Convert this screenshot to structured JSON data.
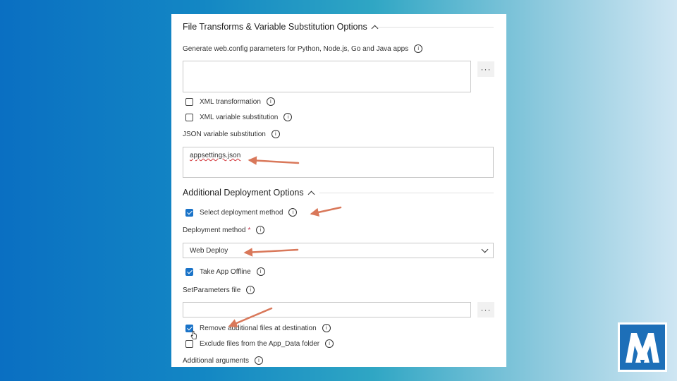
{
  "file_transforms": {
    "title": "File Transforms & Variable Substitution Options",
    "webconfig_label": "Generate web.config parameters for Python, Node.js, Go and Java apps",
    "webconfig_value": "",
    "more_button": "···",
    "xml_transformation": {
      "label": "XML transformation",
      "checked": false
    },
    "xml_variable_substitution": {
      "label": "XML variable substitution",
      "checked": false
    },
    "json_label": "JSON variable substitution",
    "json_value": "appsettings.json"
  },
  "deployment": {
    "title": "Additional Deployment Options",
    "select_method": {
      "label": "Select deployment method",
      "checked": true
    },
    "method_label": "Deployment method",
    "required_mark": "*",
    "method_value": "Web Deploy",
    "take_offline": {
      "label": "Take App Offline",
      "checked": true
    },
    "setparams_label": "SetParameters file",
    "setparams_value": "",
    "more_button": "···",
    "remove_files": {
      "label": "Remove additional files at destination",
      "checked": true
    },
    "exclude_appdata": {
      "label": "Exclude files from the App_Data folder",
      "checked": false
    },
    "additional_args_label": "Additional arguments"
  },
  "info_glyph": "i",
  "colors": {
    "annotation_arrow": "#d9785a",
    "checkbox_accent": "#1a73c8",
    "logo_blue": "#1d6fb8"
  },
  "icons": [
    "info-icon",
    "chevron-up-icon",
    "chevron-down-icon",
    "ellipsis-icon",
    "checkbox-icon"
  ]
}
